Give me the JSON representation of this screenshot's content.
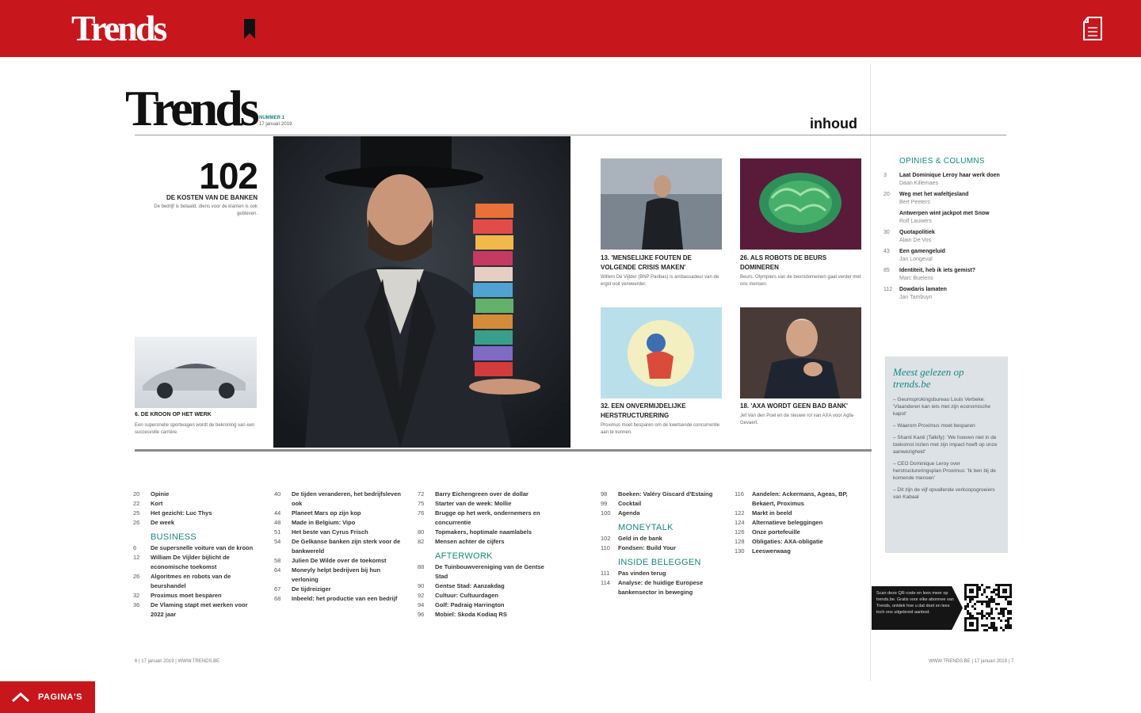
{
  "app": {
    "brand": "Trends",
    "pages_label": "PAGINA'S"
  },
  "colors": {
    "brand_red": "#c8161d",
    "accent_teal": "#19877f"
  },
  "magazine": {
    "logo": "Trends",
    "issue_number": "NUMMER 1",
    "issue_date": "17 januari 2019",
    "section_title": "inhoud",
    "cover": {
      "number": "102",
      "headline": "DE KOSTEN VAN DE BANKEN",
      "sub": "De bedrijf is betaald, diens voor de klanten is ook gebleven."
    },
    "car_caption": {
      "head": "6. DE KROON OP HET WERK",
      "sub": "Een supersnelle sportwagen wordt de bekroning van een succesvolle carrière."
    },
    "tiles": [
      {
        "head": "13. 'MENSELIJKE FOUTEN DE VOLGENDE CRISIS MAKEN'",
        "sub": "Willem De Vijlder (BNP Paribas) is ambassadeur van de ergst ooit verweerder."
      },
      {
        "head": "26. ALS ROBOTS DE BEURS DOMINEREN",
        "sub": "Beurs. Olympiers van de beursdomeinen gaat verder met ons mensen."
      },
      {
        "head": "32. EEN ONVERMIJDELIJKE HERSTRUCTURERING",
        "sub": "Proximus moet besparen om de kwetsende concurrentie aan te kunnen."
      },
      {
        "head": "18. 'AXA WORDT GEEN BAD BANK'",
        "sub": "Jef Van den Poel en de nieuwe rol van AXA voor Agfa-Gevaert."
      }
    ],
    "toc_columns": [
      {
        "rows": [
          {
            "page": "20",
            "text": "Opinie"
          },
          {
            "page": "22",
            "text": "Kort"
          },
          {
            "page": "25",
            "text": "Het gezicht: Luc Thys"
          },
          {
            "page": "26",
            "text": "De week"
          },
          {
            "section": "BUSINESS"
          },
          {
            "page": "6",
            "text": "De supersnelle voiture van de kroon"
          },
          {
            "page": "12",
            "text": "William De Vijlder bijlicht de economische toekomst"
          },
          {
            "page": "26",
            "text": "Algoritmes en robots van de beurshandel"
          },
          {
            "page": "32",
            "text": "Proximus moet besparen"
          },
          {
            "page": "36",
            "text": "De Vlaming stapt met werken voor 2022 jaar"
          }
        ]
      },
      {
        "rows": [
          {
            "page": "40",
            "text": "De tijden veranderen, het bedrijfsleven ook"
          },
          {
            "page": "44",
            "text": "Planeet Mars op zijn kop"
          },
          {
            "page": "48",
            "text": "Made in Belgium: Vipo"
          },
          {
            "page": "51",
            "text": "Het beste van Cyrus Frisch"
          },
          {
            "page": "54",
            "text": "De Gelkanse banken zijn sterk voor de bankwereld"
          },
          {
            "page": "58",
            "text": "Julien De Wilde over de toekomst"
          },
          {
            "page": "64",
            "text": "Moneyly helpt bedrijven bij hun verloning"
          },
          {
            "page": "67",
            "text": "De tijdreiziger"
          },
          {
            "page": "68",
            "text": "Inbeeld: het productie van een bedrijf"
          }
        ]
      },
      {
        "rows": [
          {
            "page": "72",
            "text": "Barry Eichengreen over de dollar"
          },
          {
            "page": "75",
            "text": "Starter van de week: Mollie"
          },
          {
            "page": "76",
            "text": "Brugge op het werk, ondernemers en concurrentie"
          },
          {
            "page": "80",
            "text": "Topmakers, hoptimale naamlabels"
          },
          {
            "page": "82",
            "text": "Mensen achter de cijfers"
          },
          {
            "section": "AFTERWORK"
          },
          {
            "page": "88",
            "text": "De Tuinbouwvereniging van de Gentse Stad"
          },
          {
            "page": "90",
            "text": "Gentse Stad: Aanzakdag"
          },
          {
            "page": "92",
            "text": "Cultuur: Cultuurdagen"
          },
          {
            "page": "94",
            "text": "Golf: Padraig Harrington"
          },
          {
            "page": "96",
            "text": "Mobiel: Skoda Kodiaq RS"
          }
        ]
      },
      {
        "rows": [
          {
            "page": "98",
            "text": "Boeken: Valéry Giscard d'Estaing"
          },
          {
            "page": "99",
            "text": "Cocktail"
          },
          {
            "page": "100",
            "text": "Agenda"
          },
          {
            "section": "MONEYTALK"
          },
          {
            "page": "102",
            "text": "Geld in de bank"
          },
          {
            "page": "110",
            "text": "Fondsen: Build Your"
          },
          {
            "section": "INSIDE BELEGGEN"
          },
          {
            "page": "111",
            "text": "Pas vinden terug"
          },
          {
            "page": "114",
            "text": "Analyse: de huidige Europese bankensector in beweging"
          }
        ]
      },
      {
        "rows": [
          {
            "page": "116",
            "text": "Aandelen: Ackermans, Ageas, BP, Bekaert, Proximus"
          },
          {
            "page": "122",
            "text": "Markt in beeld"
          },
          {
            "page": "124",
            "text": "Alternatieve beleggingen"
          },
          {
            "page": "126",
            "text": "Onze portefeuille"
          },
          {
            "page": "128",
            "text": "Obligaties: AXA-obligatie"
          },
          {
            "page": "130",
            "text": "Leeswerwaag"
          }
        ]
      }
    ],
    "opinies": {
      "title": "OPINIES & COLUMNS",
      "items": [
        {
          "page": "3",
          "title": "Laat Dominique Leroy haar werk doen",
          "author": "Daan Killemaes"
        },
        {
          "page": "20",
          "title": "Weg met het wafeltjesland",
          "author": "Bert Peeters"
        },
        {
          "page": "",
          "title": "Antwerpen wint jackpot met Snow",
          "author": "Rolf Lauwers"
        },
        {
          "page": "30",
          "title": "Quotapolitiek",
          "author": "Alain De Vos"
        },
        {
          "page": "43",
          "title": "Een gamengeluid",
          "author": "Jan Longeval"
        },
        {
          "page": "85",
          "title": "Identiteit, heb ik iets gemist?",
          "author": "Marc Buelens"
        },
        {
          "page": "112",
          "title": "Dowdaris lamaten",
          "author": "Jan Tambuyn"
        }
      ]
    },
    "most_read": {
      "title": "Meest gelezen op trends.be",
      "items": [
        "Geumsprokingsbureau Louis Verbeke: 'Vlaanderen kan iets met zijn economische kapot'",
        "Waarom Proximus moet besparen",
        "Shanti Kanti (Talkify): 'We hoeven niet in de toekomst inzien met zijn impact hoeft op onze aanwezigheid'",
        "CEO Dominique Leroy over herstructureringsplan Proximus: 'Ik ben bij de komende mensen'",
        "Dit zijn de vijf opvallende verkoopsgroeiers van Kabaal"
      ]
    },
    "qr_promo": "Scan deze QR-code en lees meer op trends.be. Gratis voor elke abonnee van Trends, ontdek hoe u dat doet en lees toch ons uitgebreid aanbod.",
    "footer_left": "6 | 17 januari 2019 | WWW.TRENDS.BE",
    "footer_right": "WWW.TRENDS.BE | 17 januari 2019 | 7"
  }
}
